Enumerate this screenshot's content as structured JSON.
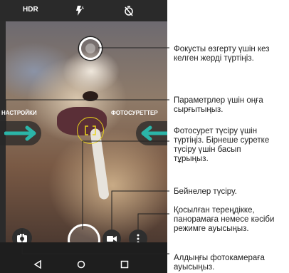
{
  "topbar": {
    "hdr": "HDR",
    "flash_icon": "flash-auto-icon",
    "timer_icon": "timer-off-icon"
  },
  "viewfinder": {
    "left_label": "НАСТРОЙКИ",
    "right_label": "ФОТОСУРЕТТЕР"
  },
  "callouts": {
    "focus": "Фокусты өзгерту үшін кез келген жерді түртіңіз.",
    "settings": "Параметрлер үшін оңға сырғытыңыз.",
    "photo": "Фотосурет түсіру үшін түртіңіз. Бірнеше суретке түсіру үшін басып тұрыңыз.",
    "video": "Бейнелер түсіру.",
    "modes": "Қосылған тереңдікке, панорамаға немесе кәсіби режимге ауысыңыз.",
    "front": "Алдыңғы фотокамераға ауысыңыз."
  },
  "colors": {
    "accent": "#2bb5a8",
    "focus_ring": "#e8d21c"
  }
}
